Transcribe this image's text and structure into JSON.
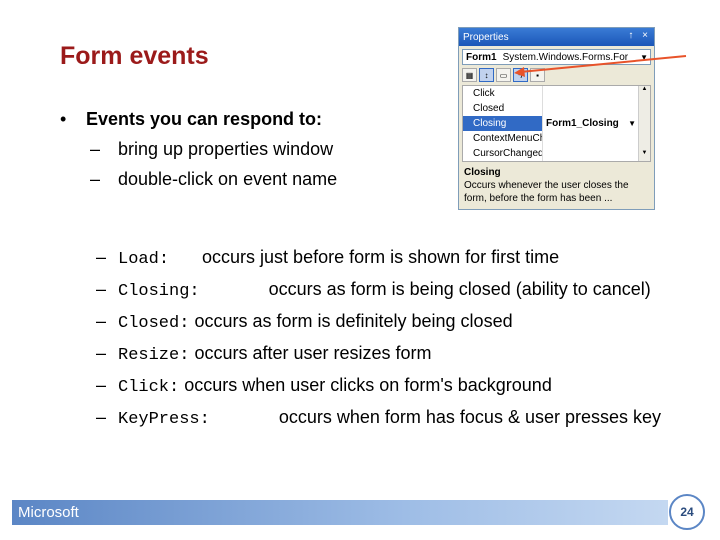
{
  "slide": {
    "title": "Form events",
    "bullet": "Events you can respond to:",
    "sub_items": [
      "bring up properties window",
      "double-click on event name"
    ],
    "events": [
      {
        "name": "Load",
        "sep": ":",
        "desc": "occurs just before form is shown for first time"
      },
      {
        "name": "Closing",
        "sep": ":",
        "desc": "occurs as form is being closed (ability to cancel)"
      },
      {
        "name": "Closed",
        "sep": ":",
        "desc": "occurs as form is definitely being closed"
      },
      {
        "name": "Resize",
        "sep": ":",
        "desc": "occurs after user resizes form"
      },
      {
        "name": "Click",
        "sep": ":",
        "desc": "occurs when user clicks on form's background"
      },
      {
        "name": "KeyPress",
        "sep": ":",
        "desc": "occurs when form has focus & user presses key"
      }
    ],
    "dash": "–",
    "bullet_glyph": "•"
  },
  "properties_window": {
    "title": "Properties",
    "controls": "↑ ×",
    "object_name": "Form1",
    "object_type": "System.Windows.Forms.For",
    "rows": [
      {
        "name": "Click",
        "value": ""
      },
      {
        "name": "Closed",
        "value": ""
      },
      {
        "name": "Closing",
        "value": "Form1_Closing",
        "selected": true
      },
      {
        "name": "ContextMenuCha",
        "value": ""
      },
      {
        "name": "CursorChanged",
        "value": ""
      }
    ],
    "desc_title": "Closing",
    "desc_text": "Occurs whenever the user closes the form, before the form has been ...",
    "arrow_color": "#e8532a"
  },
  "footer": {
    "brand": "Microsoft",
    "page_number": "24"
  }
}
